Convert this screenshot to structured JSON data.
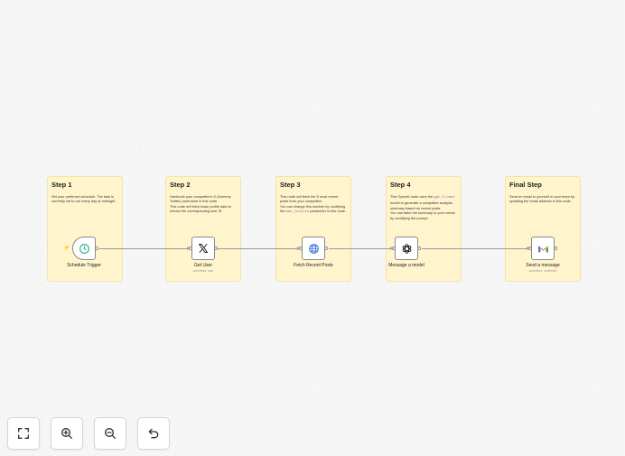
{
  "notes": [
    {
      "title": "Step 1",
      "lines": [
        "Set your preferred schedule. The task is currently set to run every day at midnight."
      ]
    },
    {
      "title": "Step 2",
      "lines": [
        "Hardcode your competitor's X (formerly Twitter) username in this node.",
        "This node will fetch basic profile data to extract the corresponding user ID"
      ]
    },
    {
      "title": "Step 3",
      "pre": "This node will fetch the 5 most recent posts from your competitor.\nYou can change this number by modifying the ",
      "code": "max_results",
      "post": " parameter in this node."
    },
    {
      "title": "Step 4",
      "pre": "This OpenAI node uses the ",
      "code": "gpt-5-nano",
      "post": " model to generate a competitor analysis summary based on recent posts.\nYou can tailor the summary to your needs by modifying the prompt."
    },
    {
      "title": "Final Step",
      "lines": [
        "Send an email to yourself or your team by updating the email address in this node."
      ]
    }
  ],
  "nodes": [
    {
      "label": "Schedule Trigger",
      "icon": "clock-icon"
    },
    {
      "label": "Get User",
      "sublabel": "undefined: user",
      "icon": "x-logo-icon"
    },
    {
      "label": "Fetch Recent Posts",
      "icon": "globe-icon"
    },
    {
      "label": "Message a model",
      "icon": "openai-icon"
    },
    {
      "label": "Send a message",
      "sublabel": "undefined: undefined",
      "icon": "gmail-icon"
    }
  ],
  "controls": {
    "fit": "fit-view-icon",
    "zoom_in": "zoom-in-icon",
    "zoom_out": "zoom-out-icon",
    "reset": "reset-zoom-icon"
  },
  "colors": {
    "note_bg": "#fff4cc",
    "trigger_accent": "#ff6d5a",
    "clock_green": "#35b59a"
  }
}
